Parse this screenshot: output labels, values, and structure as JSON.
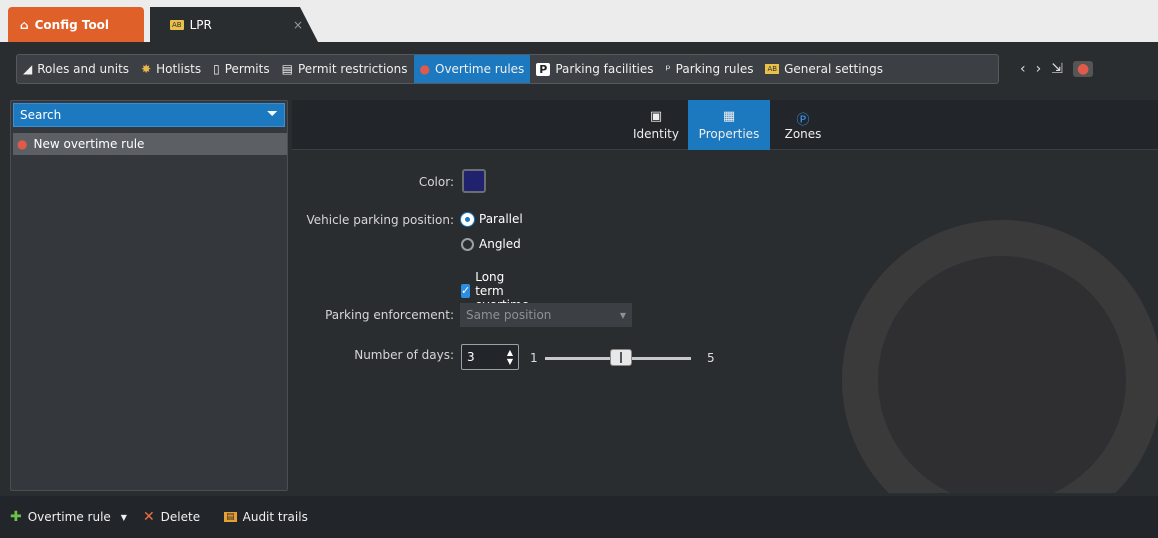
{
  "tabs": {
    "config_tool": "Config Tool",
    "lpr": "LPR",
    "close_symbol": "×"
  },
  "nav": {
    "items": [
      {
        "label": "Roles and units",
        "icon": "roles-icon"
      },
      {
        "label": "Hotlists",
        "icon": "hotlist-icon"
      },
      {
        "label": "Permits",
        "icon": "permit-icon"
      },
      {
        "label": "Permit restrictions",
        "icon": "permit-restrictions-icon"
      },
      {
        "label": "Overtime rules",
        "icon": "overtime-icon",
        "active": true
      },
      {
        "label": "Parking facilities",
        "icon": "parking-facility-icon"
      },
      {
        "label": "Parking rules",
        "icon": "parking-rules-icon"
      },
      {
        "label": "General settings",
        "icon": "general-settings-icon"
      }
    ],
    "back": "‹",
    "forward": "›"
  },
  "sidebar": {
    "search_placeholder": "Search",
    "items": [
      "New overtime rule"
    ]
  },
  "subtabs": [
    {
      "label": "Identity",
      "icon": "identity-icon"
    },
    {
      "label": "Properties",
      "icon": "properties-icon",
      "active": true
    },
    {
      "label": "Zones",
      "icon": "zones-icon"
    }
  ],
  "form": {
    "color_label": "Color:",
    "color_value": "#21226e",
    "parking_position_label": "Vehicle parking position:",
    "parallel_label": "Parallel",
    "angled_label": "Angled",
    "parking_position_selected": "Parallel",
    "long_term_label": "Long term overtime",
    "long_term_checked": true,
    "enforcement_label": "Parking enforcement:",
    "enforcement_value": "Same position",
    "days_label": "Number of days:",
    "days_value": "3",
    "slider_min": "1",
    "slider_max": "5",
    "slider_value": 3
  },
  "bottom": {
    "add_label": "Overtime rule",
    "delete_label": "Delete",
    "audit_label": "Audit trails"
  },
  "colors": {
    "accent": "#1c79c0",
    "config_tab": "#e0602a",
    "background": "#2a2d30"
  }
}
